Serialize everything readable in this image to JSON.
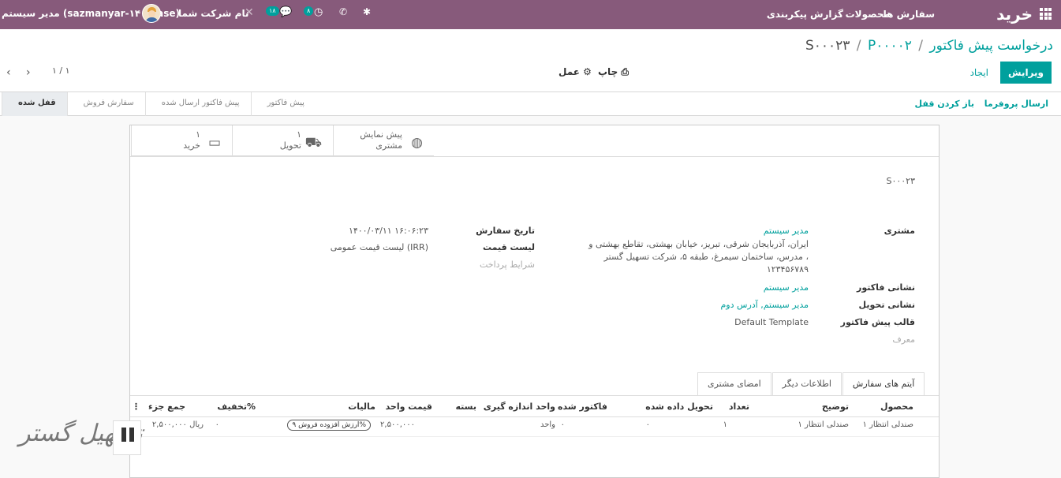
{
  "topbar": {
    "app_title": "خرید",
    "menu": [
      "سفارش ها",
      "محصولات",
      "گزارش",
      "پیکربندی"
    ],
    "company": "نام شرکت شما",
    "user": "مدیر سیستم (sazmanyar-۱۴۰-base)",
    "chat_count": "۱۸",
    "activity_count": "۸"
  },
  "breadcrumb": {
    "parent": "درخواست پیش فاکتور",
    "sep": "/",
    "mid": "P۰۰۰۰۲",
    "current": "S۰۰۰۲۳"
  },
  "actions": {
    "edit": "ویرایش",
    "create": "ایجاد",
    "print": "چاپ",
    "action": "عمل",
    "pager": "۱ / ۱"
  },
  "statusbar": {
    "send_proforma": "ارسال پروفرما",
    "unlock": "باز کردن قفل",
    "stages": [
      "پیش فاکتور",
      "پیش فاکتور ارسال شده",
      "سفارش فروش",
      "قفل شده"
    ],
    "active_stage": 3
  },
  "smart_buttons": [
    {
      "line1": "پیش نمایش",
      "line2": "مشتری",
      "icon": "globe-icon"
    },
    {
      "line1": "۱",
      "line2": "تحویل",
      "icon": "truck-icon"
    },
    {
      "line1": "۱",
      "line2": "خرید",
      "icon": "credit-card-icon"
    }
  ],
  "document": {
    "name": "S۰۰۰۲۳",
    "customer_label": "مشتری",
    "customer_name": "مدیر سیستم",
    "address_line1": "ایران، آذربایجان شرقی، تبریز، خیابان بهشتی، تقاطع بهشتی و",
    "address_line2": "مدرس، ساختمان سیمرغ، طبقه ۵، شرکت تسهیل گستر ،",
    "address_line3": "۱۲۳۴۵۶۷۸۹",
    "invoice_address_label": "نشانی فاکتور",
    "invoice_address": "مدیر سیستم",
    "delivery_address_label": "نشانی تحویل",
    "delivery_address": "مدیر سیستم, آدرس دوم",
    "template_label": "قالب پیش فاکتور",
    "template": "Default Template",
    "referrer": "معرف",
    "order_date_label": "تاریخ سفارش",
    "order_date": "۱۴۰۰/۰۳/۱۱ ۱۶:۰۶:۲۳",
    "pricelist_label": "لیست قیمت",
    "pricelist": "لیست قیمت عمومی (IRR)",
    "payment_terms": "شرایط پرداخت"
  },
  "tabs": [
    "آیتم های سفارش",
    "اطلاعات دیگر",
    "امضای مشتری"
  ],
  "table": {
    "headers": [
      "محصول",
      "توضیح",
      "تعداد",
      "تحویل داده شده",
      "فاکتور شده",
      "واحد اندازه گیری",
      "بسته",
      "قیمت واحد",
      "مالیات",
      "تخفیف%",
      "جمع جزء"
    ],
    "rows": [
      {
        "product": "صندلی انتظار ۱",
        "description": "صندلی انتظار ۱",
        "qty": "۱",
        "delivered": "۰",
        "invoiced": "۰",
        "uom": "واحد",
        "package": "",
        "price": "۲,۵۰۰,۰۰۰",
        "tax": "ارزش افزوده فروش ۹%",
        "discount": "۰",
        "subtotal": "۲,۵۰۰,۰۰۰ ریال"
      }
    ]
  },
  "watermark": "تسهیل گستر"
}
